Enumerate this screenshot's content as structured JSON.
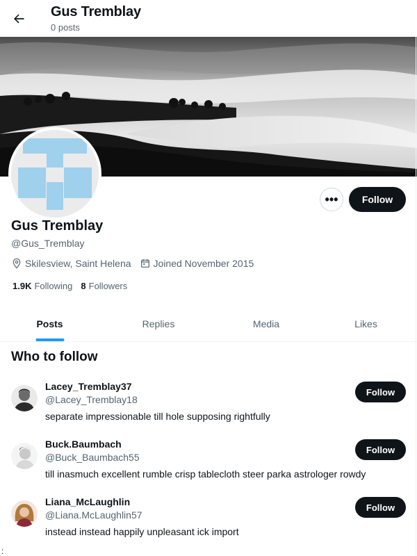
{
  "header": {
    "title": "Gus Tremblay",
    "post_count": "0 posts"
  },
  "profile": {
    "name": "Gus Tremblay",
    "handle": "@Gus_Tremblay",
    "location": "Skilesview, Saint Helena",
    "joined": "Joined November 2015",
    "following_count": "1.9K",
    "following_label": "Following",
    "followers_count": "8",
    "followers_label": "Followers",
    "follow_label": "Follow",
    "more_label": "•••",
    "avatar_color": "#9fd0ec"
  },
  "tabs": [
    {
      "label": "Posts",
      "active": true
    },
    {
      "label": "Replies",
      "active": false
    },
    {
      "label": "Media",
      "active": false
    },
    {
      "label": "Likes",
      "active": false
    }
  ],
  "who_to_follow": {
    "title": "Who to follow",
    "users": [
      {
        "name": "Lacey_Tremblay37",
        "handle": "@Lacey_Tremblay18",
        "bio": "separate impressionable till hole supposing rightfully",
        "follow_label": "Follow"
      },
      {
        "name": "Buck.Baumbach",
        "handle": "@Buck_Baumbach55",
        "bio": "till inasmuch excellent rumble crisp tablecloth steer parka astrologer rowdy",
        "follow_label": "Follow"
      },
      {
        "name": "Liana_McLaughlin",
        "handle": "@Liana.McLaughlin57",
        "bio": "instead instead happily unpleasant ick import",
        "follow_label": "Follow"
      }
    ]
  },
  "stray_mark": ":",
  "colors": {
    "accent": "#1d9bf0",
    "button_dark": "#0f1419",
    "secondary_text": "#536471"
  }
}
